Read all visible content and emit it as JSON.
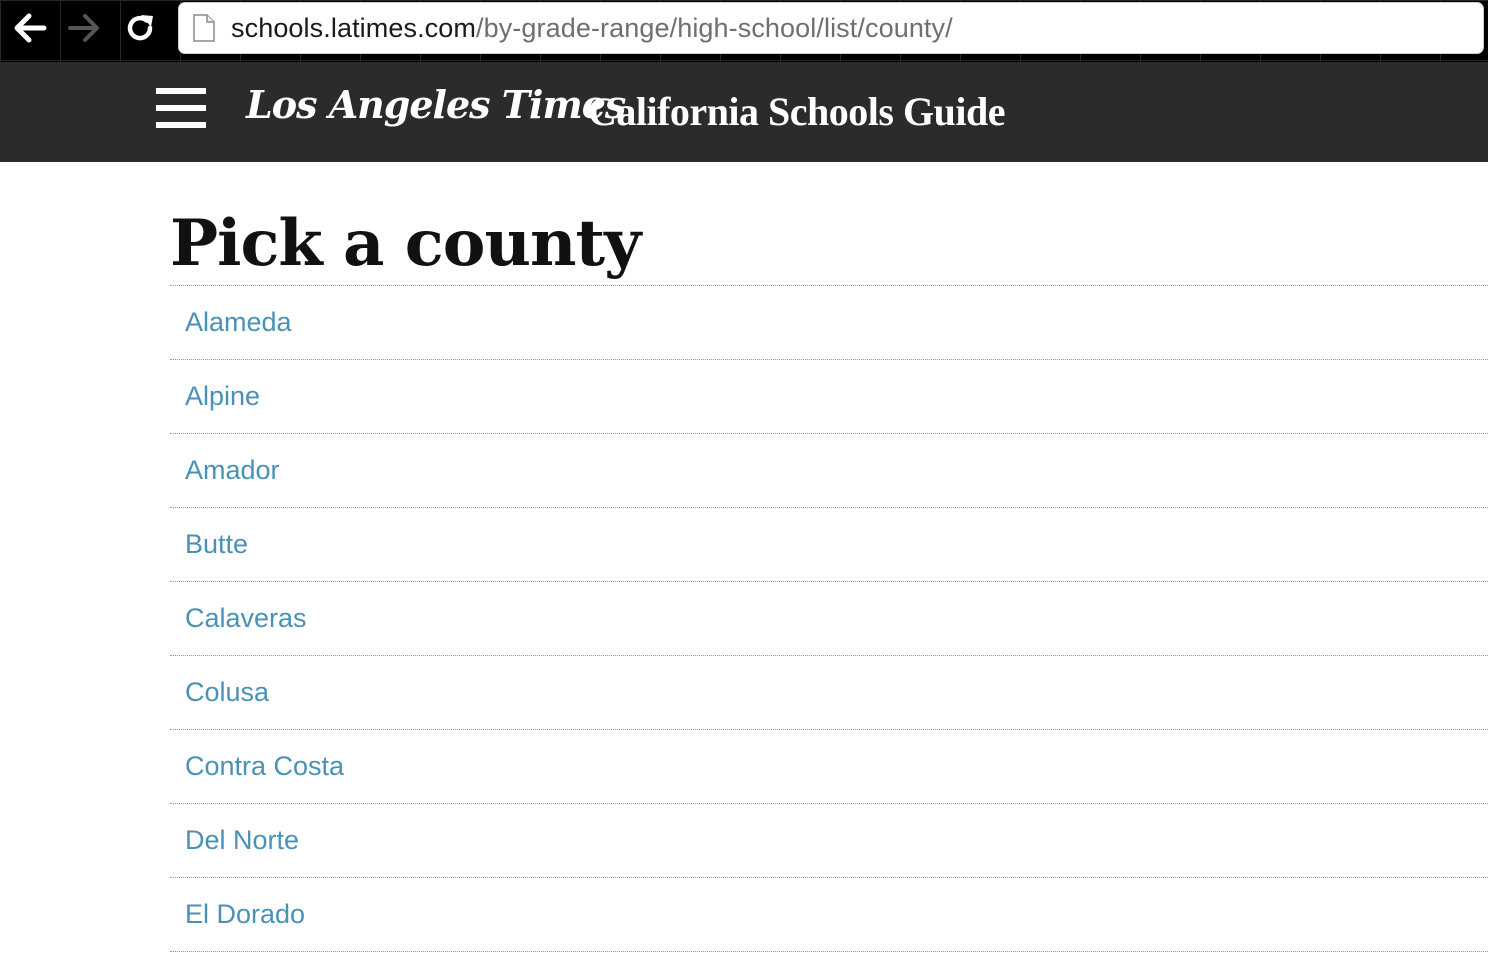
{
  "browser": {
    "url_domain": "schools.latimes.com",
    "url_path": "/by-grade-range/high-school/list/county/"
  },
  "header": {
    "logo_text": "Los Angeles Times",
    "guide_title": "California Schools Guide"
  },
  "main": {
    "title": "Pick a county",
    "counties": [
      {
        "label": "Alameda"
      },
      {
        "label": "Alpine"
      },
      {
        "label": "Amador"
      },
      {
        "label": "Butte"
      },
      {
        "label": "Calaveras"
      },
      {
        "label": "Colusa"
      },
      {
        "label": "Contra Costa"
      },
      {
        "label": "Del Norte"
      },
      {
        "label": "El Dorado"
      }
    ]
  },
  "colors": {
    "header_bg": "#2b2b2b",
    "link": "#4a92b5",
    "browser_bg": "#000000"
  },
  "icons": {
    "back": "arrow-left-icon",
    "forward": "arrow-right-icon",
    "reload": "reload-icon",
    "page": "page-icon",
    "menu": "hamburger-menu-icon"
  }
}
